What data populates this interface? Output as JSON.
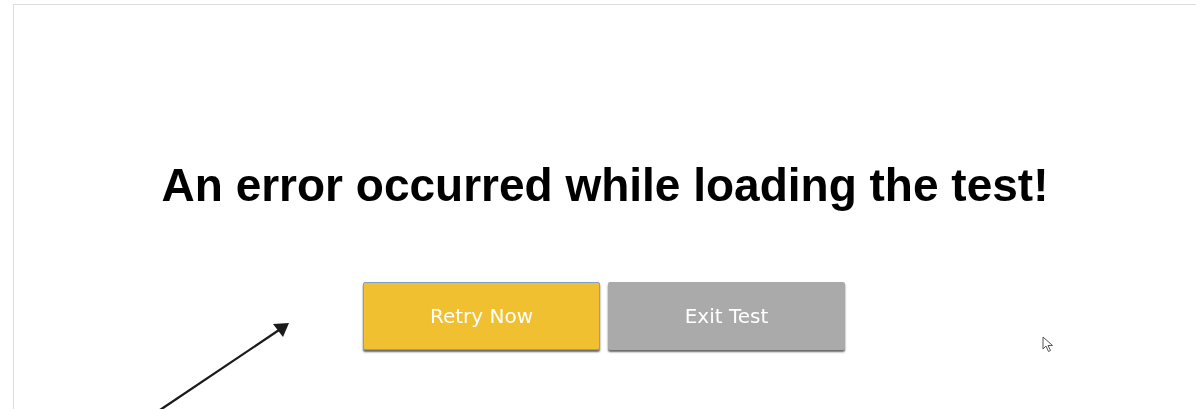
{
  "message": {
    "title": "An error occurred while loading the test!"
  },
  "buttons": [
    {
      "label": "Retry Now",
      "kind": "primary"
    },
    {
      "label": "Exit Test",
      "kind": "secondary"
    }
  ]
}
